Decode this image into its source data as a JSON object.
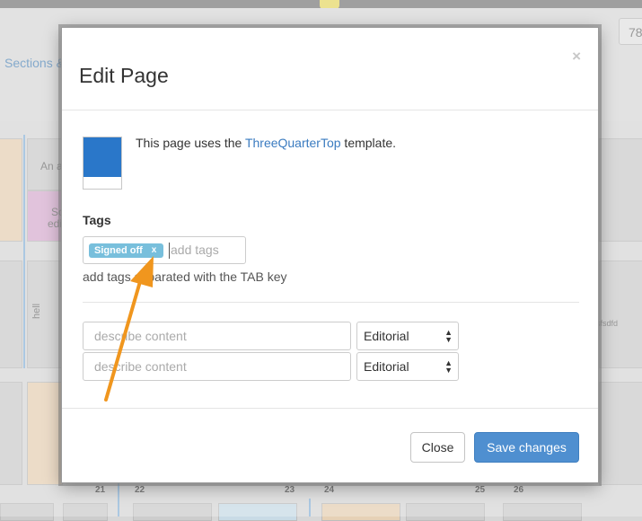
{
  "background": {
    "sections_link": "Sections &",
    "page_number": "78",
    "block_text_1": "An ad",
    "block_text_2": "So",
    "block_text_3": "edi",
    "vertical_text": "hell",
    "scroll_text": "sfsdfd",
    "column_numbers": [
      "21",
      "22",
      "23",
      "24",
      "25",
      "26"
    ]
  },
  "modal": {
    "title": "Edit Page",
    "close_glyph": "×",
    "template": {
      "prefix": "This page uses the ",
      "name": "ThreeQuarterTop",
      "suffix": " template."
    },
    "tags": {
      "label": "Tags",
      "chips": [
        {
          "label": "Signed off",
          "remove": "x"
        }
      ],
      "add_placeholder": "add tags",
      "help": "add tags separated with the TAB key"
    },
    "content_rows": [
      {
        "placeholder": "describe content",
        "section": "Editorial"
      },
      {
        "placeholder": "describe content",
        "section": "Editorial"
      }
    ],
    "footer": {
      "close_label": "Close",
      "save_label": "Save changes"
    }
  },
  "colors": {
    "accent": "#4f8fd0",
    "tag_chip": "#78bfdc",
    "template_thumb": "#2a77c9",
    "annotation_arrow": "#f0961e"
  }
}
